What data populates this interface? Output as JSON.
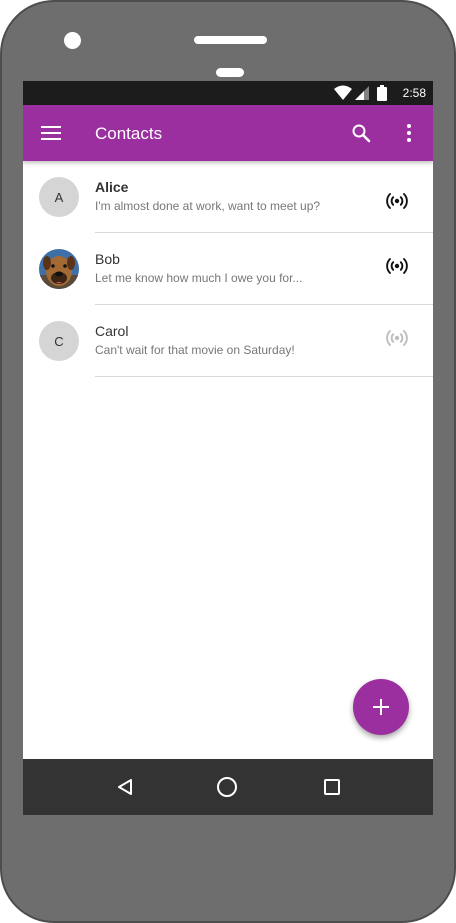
{
  "status_bar": {
    "time": "2:58"
  },
  "app_bar": {
    "title": "Contacts"
  },
  "contacts": [
    {
      "initial": "A",
      "name": "Alice",
      "message": "I'm almost done at work, want to meet up?",
      "unread": true,
      "online": true
    },
    {
      "initial": "",
      "name": "Bob",
      "message": "Let me know how much I owe you for...",
      "unread": false,
      "online": true
    },
    {
      "initial": "C",
      "name": "Carol",
      "message": "Can't wait for that movie on Saturday!",
      "unread": false,
      "online": false
    }
  ],
  "colors": {
    "primary": "#9c2f9f",
    "status_bar": "#1c1c1c",
    "nav_bar": "#333333",
    "phone_body": "#6e6e6e"
  },
  "icons": {
    "menu": "menu-icon",
    "search": "search-icon",
    "more": "more-vert-icon",
    "fab": "plus-icon",
    "presence": "broadcast-icon"
  }
}
